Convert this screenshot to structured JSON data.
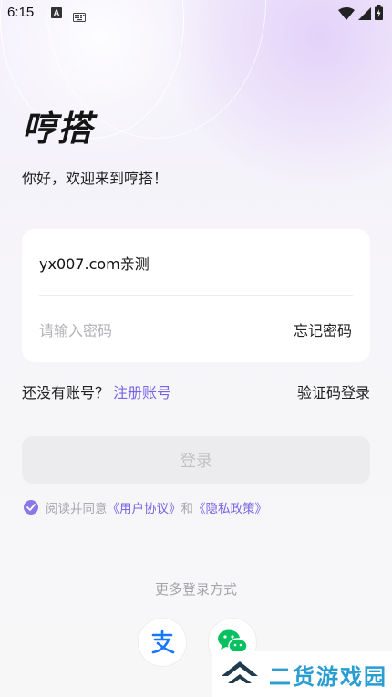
{
  "status_bar": {
    "time": "6:15",
    "a_badge": "A"
  },
  "app": {
    "title": "哼搭",
    "welcome": "你好，欢迎来到哼搭！"
  },
  "login_form": {
    "username_value": "yx007.com亲测",
    "password_placeholder": "请输入密码",
    "forgot_password": "忘记密码"
  },
  "register": {
    "prompt": "还没有账号？",
    "link": "注册账号",
    "code_login": "验证码登录"
  },
  "login_button": "登录",
  "agreement": {
    "prefix": "阅读并同意",
    "user_agreement": "《用户协议》",
    "and": "和",
    "privacy_policy": "《隐私政策》"
  },
  "more_login": "更多登录方式",
  "social": [
    "alipay-icon",
    "wechat-icon"
  ],
  "watermark": "二货游戏园",
  "colors": {
    "accent": "#7b64e6",
    "alipay": "#1677ff",
    "wechat": "#07c160",
    "watermark": "#2a9dd1"
  }
}
